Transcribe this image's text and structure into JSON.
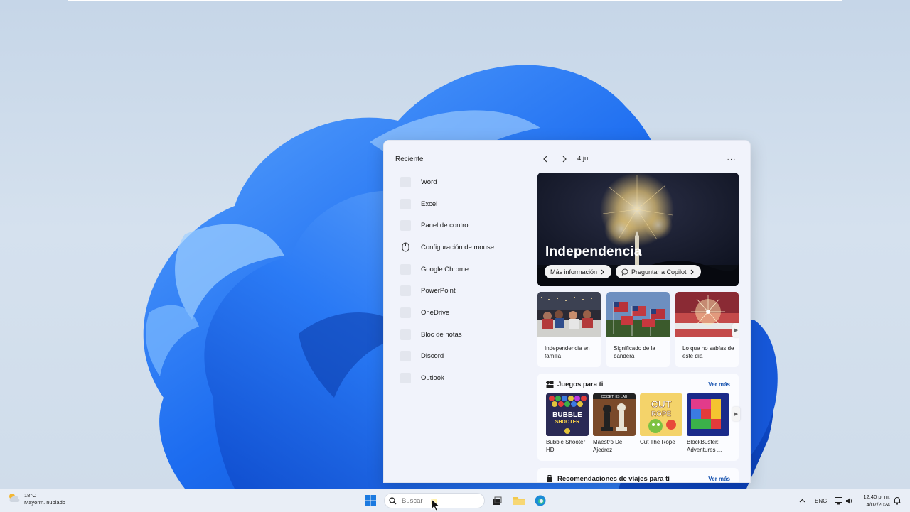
{
  "search_panel": {
    "recent_title": "Reciente",
    "recent_items": [
      {
        "label": "Word",
        "icon": "word-icon"
      },
      {
        "label": "Excel",
        "icon": "excel-icon"
      },
      {
        "label": "Panel de control",
        "icon": "control-panel-icon"
      },
      {
        "label": "Configuración de mouse",
        "icon": "mouse-icon"
      },
      {
        "label": "Google Chrome",
        "icon": "chrome-icon"
      },
      {
        "label": "PowerPoint",
        "icon": "powerpoint-icon"
      },
      {
        "label": "OneDrive",
        "icon": "onedrive-icon"
      },
      {
        "label": "Bloc de notas",
        "icon": "notepad-icon"
      },
      {
        "label": "Discord",
        "icon": "discord-icon"
      },
      {
        "label": "Outlook",
        "icon": "outlook-icon"
      }
    ],
    "date": "4 jul",
    "more_label": "···",
    "hero": {
      "title": "Independencia",
      "more_info": "Más información",
      "ask_copilot": "Preguntar a Copilot"
    },
    "cards": [
      {
        "text": "Independencia en familia"
      },
      {
        "text": "Significado de la bandera"
      },
      {
        "text": "Lo que no sabías de este día"
      }
    ],
    "games": {
      "title": "Juegos para ti",
      "see_more": "Ver más",
      "items": [
        {
          "name": "Bubble Shooter HD",
          "logo_text": "BUBBLE SHOOTER"
        },
        {
          "name": "Maestro De Ajedrez",
          "logo_text": "CODETHIS LAB"
        },
        {
          "name": "Cut The Rope",
          "logo_text": "CUT ROPE"
        },
        {
          "name": "BlockBuster: Adventures ..."
        }
      ]
    },
    "travel": {
      "title": "Recomendaciones de viajes para ti",
      "see_more": "Ver más"
    }
  },
  "taskbar": {
    "weather_temp": "18°C",
    "weather_desc": "Mayorm. nublado",
    "search_placeholder": "Buscar",
    "language": "ENG",
    "time": "12:40 p. m.",
    "date": "4/07/2024"
  },
  "colors": {
    "accent": "#1a55b0",
    "wallpaper_blue": "#1e6ef0"
  }
}
